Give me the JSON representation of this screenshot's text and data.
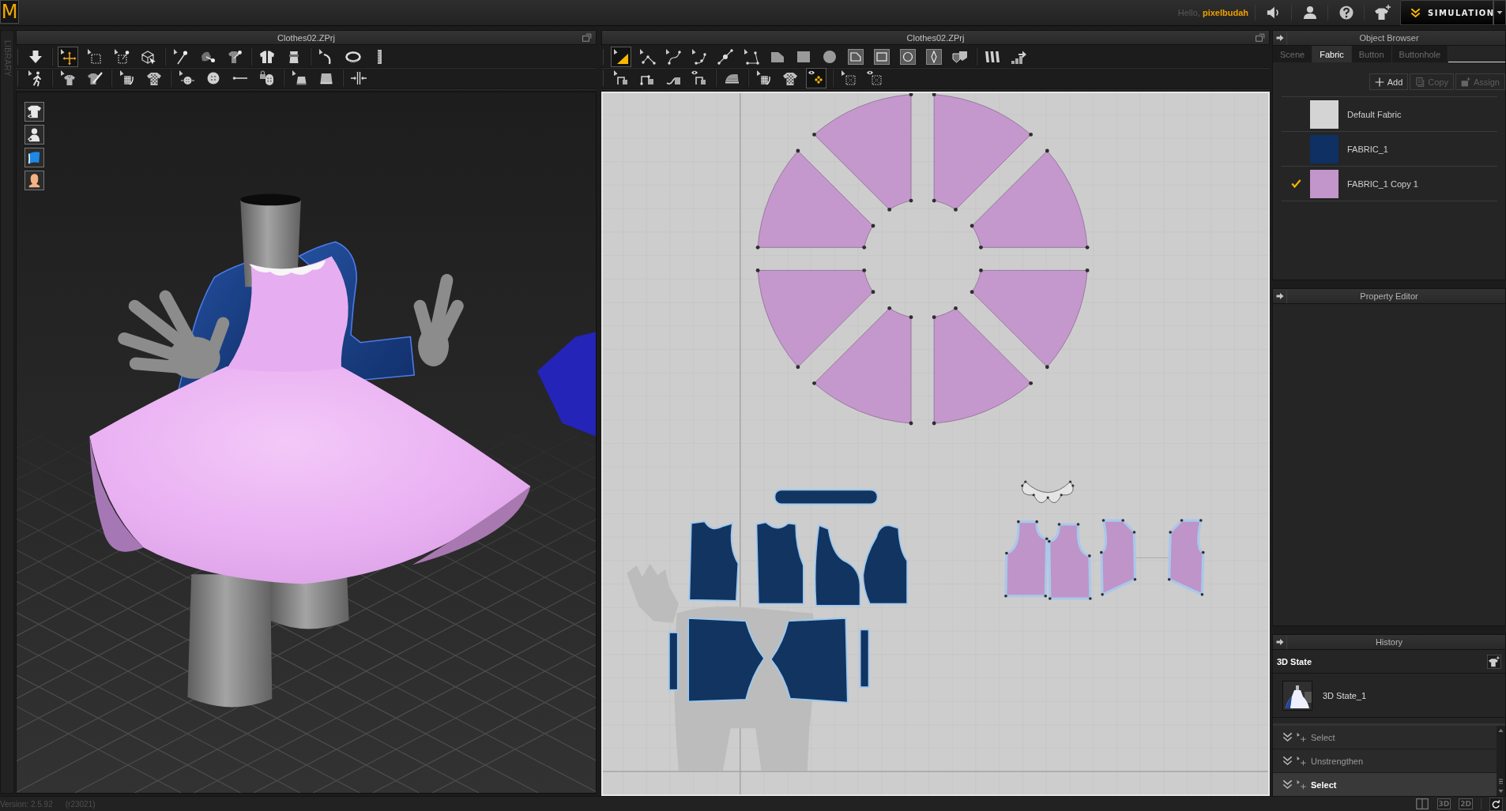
{
  "top_bar": {
    "logo": "M",
    "greeting": "Hello, **pixelbudah**",
    "mode_button": "SIMULATION"
  },
  "library_tab": "LIBRARY",
  "view_3d": {
    "title": "Clothes02.ZPrj",
    "toolbars": [
      {
        "groups": [
          {
            "tools": [
              {
                "kind": "arrow-down",
                "selected": false
              }
            ]
          },
          {
            "tools": [
              {
                "kind": "move",
                "selected": true
              },
              {
                "kind": "select-box",
                "selected": false
              },
              {
                "kind": "select-point",
                "selected": false
              },
              {
                "kind": "transform-box",
                "selected": false
              }
            ]
          },
          {
            "tools": [
              {
                "kind": "pin",
                "selected": false
              },
              {
                "kind": "blob-pin",
                "selected": false
              },
              {
                "kind": "shirt-pin",
                "selected": false
              }
            ]
          },
          {
            "tools": [
              {
                "kind": "shirt",
                "selected": false
              },
              {
                "kind": "torso",
                "selected": false
              }
            ]
          },
          {
            "tools": [
              {
                "kind": "tape-curve",
                "selected": false
              },
              {
                "kind": "tape-ring",
                "selected": false
              },
              {
                "kind": "ruler",
                "selected": false
              }
            ]
          }
        ]
      },
      {
        "groups": [
          {
            "tools": [
              {
                "kind": "walk",
                "selected": false
              }
            ]
          },
          {
            "tools": [
              {
                "kind": "shirt-cursor",
                "selected": false
              },
              {
                "kind": "shirt-brush",
                "selected": false
              }
            ]
          },
          {
            "tools": [
              {
                "kind": "mesh-cursor",
                "selected": false
              },
              {
                "kind": "checker-shirt",
                "selected": false
              }
            ]
          },
          {
            "tools": [
              {
                "kind": "button-cursor",
                "selected": false
              },
              {
                "kind": "button",
                "selected": false
              },
              {
                "kind": "line",
                "selected": false
              },
              {
                "kind": "lock-button",
                "selected": false
              }
            ]
          },
          {
            "tools": [
              {
                "kind": "plane-cursor",
                "selected": false
              },
              {
                "kind": "plane",
                "selected": false
              }
            ]
          },
          {
            "tools": [
              {
                "kind": "zipper",
                "selected": false
              }
            ]
          }
        ]
      }
    ],
    "side_tools": [
      {
        "kind": "shirt-view"
      },
      {
        "kind": "avatar-view"
      },
      {
        "kind": "fabric-sheet"
      },
      {
        "kind": "head"
      }
    ]
  },
  "view_2d": {
    "title": "Clothes02.ZPrj",
    "toolbars": [
      {
        "groups": [
          {
            "tools": [
              {
                "kind": "tri-cursor",
                "selected": true
              },
              {
                "kind": "polyline",
                "selected": false
              },
              {
                "kind": "curve",
                "selected": false
              },
              {
                "kind": "curve-points",
                "selected": false
              },
              {
                "kind": "midpoint",
                "selected": false
              },
              {
                "kind": "angle",
                "selected": false
              },
              {
                "kind": "polygon",
                "selected": false
              },
              {
                "kind": "rect",
                "selected": false
              },
              {
                "kind": "circle",
                "selected": false
              },
              {
                "kind": "polygon-tile",
                "selected": false
              },
              {
                "kind": "rect-tile",
                "selected": false
              },
              {
                "kind": "circle-tile",
                "selected": false
              },
              {
                "kind": "dart-tile",
                "selected": false
              },
              {
                "kind": "shield",
                "selected": false
              }
            ]
          },
          {
            "tools": [
              {
                "kind": "bars",
                "selected": false
              },
              {
                "kind": "steps",
                "selected": false
              }
            ]
          }
        ]
      },
      {
        "groups": [
          {
            "tools": [
              {
                "kind": "seam-cursor",
                "selected": false
              },
              {
                "kind": "seam",
                "selected": false
              },
              {
                "kind": "seam-curve",
                "selected": false
              },
              {
                "kind": "seam-eye",
                "selected": false
              }
            ]
          },
          {
            "tools": [
              {
                "kind": "iron",
                "selected": false
              }
            ]
          },
          {
            "tools": [
              {
                "kind": "mesh-cursor",
                "selected": false
              },
              {
                "kind": "checker-shirt",
                "selected": false
              },
              {
                "kind": "eye-dots",
                "selected": true
              }
            ]
          },
          {
            "tools": [
              {
                "kind": "grid-cursor",
                "selected": false
              },
              {
                "kind": "grid-eye",
                "selected": false
              }
            ]
          }
        ]
      }
    ]
  },
  "object_browser": {
    "title": "Object Browser",
    "tabs": [
      {
        "label": "Scene",
        "selected": false
      },
      {
        "label": "Fabric",
        "selected": true
      },
      {
        "label": "Button",
        "selected": false
      },
      {
        "label": "Buttonhole",
        "selected": false
      }
    ],
    "actions": [
      {
        "kind": "add",
        "label": "Add",
        "disabled": false
      },
      {
        "kind": "copy",
        "label": "Copy",
        "disabled": true
      },
      {
        "kind": "assign",
        "label": "Assign",
        "disabled": true
      }
    ],
    "fabrics": [
      {
        "name": "Default Fabric",
        "color": "#d4d4d4",
        "checked": false
      },
      {
        "name": "FABRIC_1",
        "color": "#0e3062",
        "checked": false
      },
      {
        "name": "FABRIC_1 Copy 1",
        "color": "#c296ca",
        "checked": true
      }
    ]
  },
  "property_editor": {
    "title": "Property Editor"
  },
  "history": {
    "title": "History",
    "state_heading": "3D State",
    "states": [
      {
        "name": "3D State_1"
      }
    ],
    "actions": [
      {
        "label": "Select",
        "selected": false
      },
      {
        "label": "Unstrengthen",
        "selected": false
      },
      {
        "label": "Select",
        "selected": true
      }
    ]
  },
  "status_bar": {
    "version": "Version: 2.5.92",
    "revision": "(r23021)",
    "view_buttons": [
      {
        "kind": "split"
      },
      {
        "kind": "label",
        "label": "3D"
      },
      {
        "kind": "label",
        "label": "2D"
      },
      {
        "kind": "refresh"
      }
    ]
  }
}
